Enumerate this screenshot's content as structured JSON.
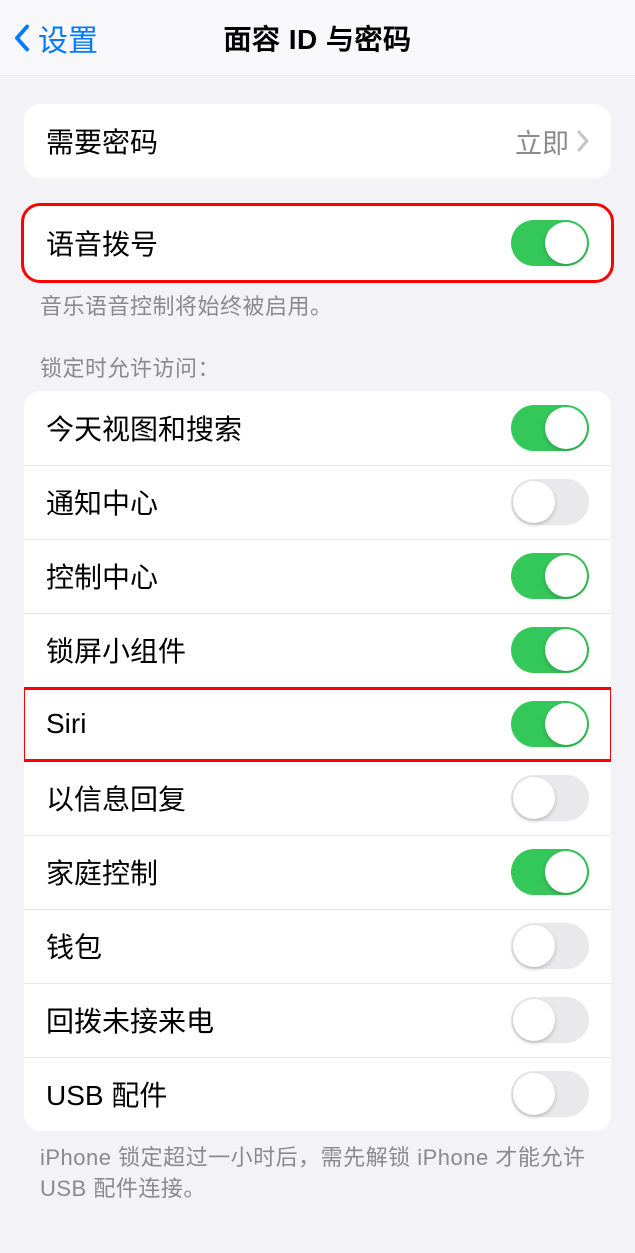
{
  "nav": {
    "back_label": "设置",
    "title": "面容 ID 与密码"
  },
  "require_passcode": {
    "label": "需要密码",
    "value": "立即"
  },
  "voice_dial": {
    "label": "语音拨号",
    "on": true,
    "footnote": "音乐语音控制将始终被启用。"
  },
  "lock_section": {
    "header": "锁定时允许访问：",
    "items": [
      {
        "key": "today",
        "label": "今天视图和搜索",
        "on": true
      },
      {
        "key": "notifications",
        "label": "通知中心",
        "on": false
      },
      {
        "key": "control",
        "label": "控制中心",
        "on": true
      },
      {
        "key": "widgets",
        "label": "锁屏小组件",
        "on": true
      },
      {
        "key": "siri",
        "label": "Siri",
        "on": true
      },
      {
        "key": "reply",
        "label": "以信息回复",
        "on": false
      },
      {
        "key": "home",
        "label": "家庭控制",
        "on": true
      },
      {
        "key": "wallet",
        "label": "钱包",
        "on": false
      },
      {
        "key": "callback",
        "label": "回拨未接来电",
        "on": false
      },
      {
        "key": "usb",
        "label": "USB 配件",
        "on": false
      }
    ],
    "footnote": "iPhone 锁定超过一小时后，需先解锁 iPhone 才能允许 USB 配件连接。"
  }
}
